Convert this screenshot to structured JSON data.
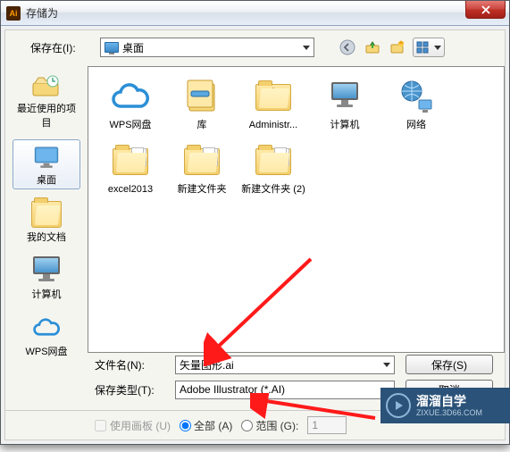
{
  "title": "存储为",
  "app_badge": "Ai",
  "save_in_label": "保存在(I):",
  "location": "桌面",
  "toolbar": {
    "back": "后退",
    "up": "向上",
    "new_folder": "新建文件夹",
    "view": "视图"
  },
  "sidebar": [
    {
      "id": "recent",
      "label": "最近使用的项目"
    },
    {
      "id": "desktop",
      "label": "桌面",
      "selected": true
    },
    {
      "id": "mydocs",
      "label": "我的文档"
    },
    {
      "id": "computer",
      "label": "计算机"
    },
    {
      "id": "wps",
      "label": "WPS网盘"
    }
  ],
  "files": [
    {
      "id": "wps",
      "label": "WPS网盘",
      "kind": "cloud"
    },
    {
      "id": "lib",
      "label": "库",
      "kind": "library"
    },
    {
      "id": "admin",
      "label": "Administr...",
      "kind": "userfolder"
    },
    {
      "id": "computer",
      "label": "计算机",
      "kind": "pc"
    },
    {
      "id": "network",
      "label": "网络",
      "kind": "network"
    },
    {
      "id": "excel",
      "label": "excel2013",
      "kind": "folder-sheets"
    },
    {
      "id": "newf1",
      "label": "新建文件夹",
      "kind": "folder-sheets"
    },
    {
      "id": "newf2",
      "label": "新建文件夹 (2)",
      "kind": "folder-sheets"
    }
  ],
  "filename_label": "文件名(N):",
  "filename_value": "矢量图形.ai",
  "filetype_label": "保存类型(T):",
  "filetype_value": "Adobe Illustrator (*.AI)",
  "save_btn": "保存(S)",
  "cancel_btn": "取消",
  "use_artboard_label": "使用画板 (U)",
  "all_label": "全部 (A)",
  "range_label": "范围 (G):",
  "range_value": "1",
  "watermark_cn": "溜溜自学",
  "watermark_en": "ZIXUE.3D66.COM"
}
